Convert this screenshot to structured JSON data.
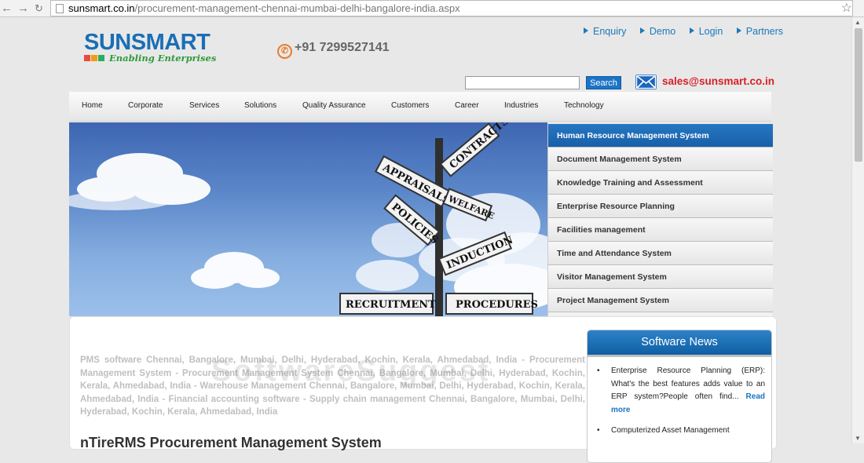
{
  "browser": {
    "url_host": "sunsmart.co.in",
    "url_path": "/procurement-management-chennai-mumbai-delhi-bangalore-india.aspx"
  },
  "logo": {
    "name": "SUNSMART",
    "tagline": "Enabling Enterprises"
  },
  "phone": "+91 7299527141",
  "top_links": [
    "Enquiry",
    "Demo",
    "Login",
    "Partners"
  ],
  "search": {
    "button": "Search",
    "value": ""
  },
  "email": "sales@sunsmart.co.in",
  "nav": [
    "Home",
    "Corporate",
    "Services",
    "Solutions",
    "Quality Assurance",
    "Customers",
    "Career",
    "Industries",
    "Technology"
  ],
  "banner_signs": [
    "CONTRACTS",
    "APPRAISALS",
    "WELFARE",
    "POLICIES",
    "INDUCTION",
    "RECRUITMENT",
    "PROCEDURES"
  ],
  "side_menu": [
    "Human Resource Management System",
    "Document Management System",
    "Knowledge Training and Assessment",
    "Enterprise Resource Planning",
    "Facilities management",
    "Time and Attendance System",
    "Visitor Management System",
    "Project Management System"
  ],
  "intro_text": "PMS software Chennai, Bangalore, Mumbai, Delhi, Hyderabad, Kochin, Kerala, Ahmedabad, India - Procurement Management System - Procurement Management System Chennai, Bangalore, Mumbai, Delhi, Hyderabad, Kochin, Kerala, Ahmedabad, India - Warehouse Management Chennai, Bangalore, Mumbai, Delhi, Hyderabad, Kochin, Kerala, Ahmedabad, India - Financial accounting software - Supply chain management Chennai, Bangalore, Mumbai, Delhi, Hyderabad, Kochin, Kerala, Ahmedabad, India",
  "watermark": "SoftwareSuggest",
  "product_title": "nTireRMS Procurement Management System",
  "news": {
    "title": "Software News",
    "items": [
      {
        "text": "Enterprise Resource Planning (ERP): What's the best features adds value to an ERP system?People often find...",
        "link": "Read more"
      },
      {
        "text": "Computerized Asset Management",
        "link": ""
      }
    ]
  },
  "colors": {
    "brand_blue": "#1a6fb5",
    "accent_red": "#d62027",
    "menu_active": "#1b6bb7"
  }
}
